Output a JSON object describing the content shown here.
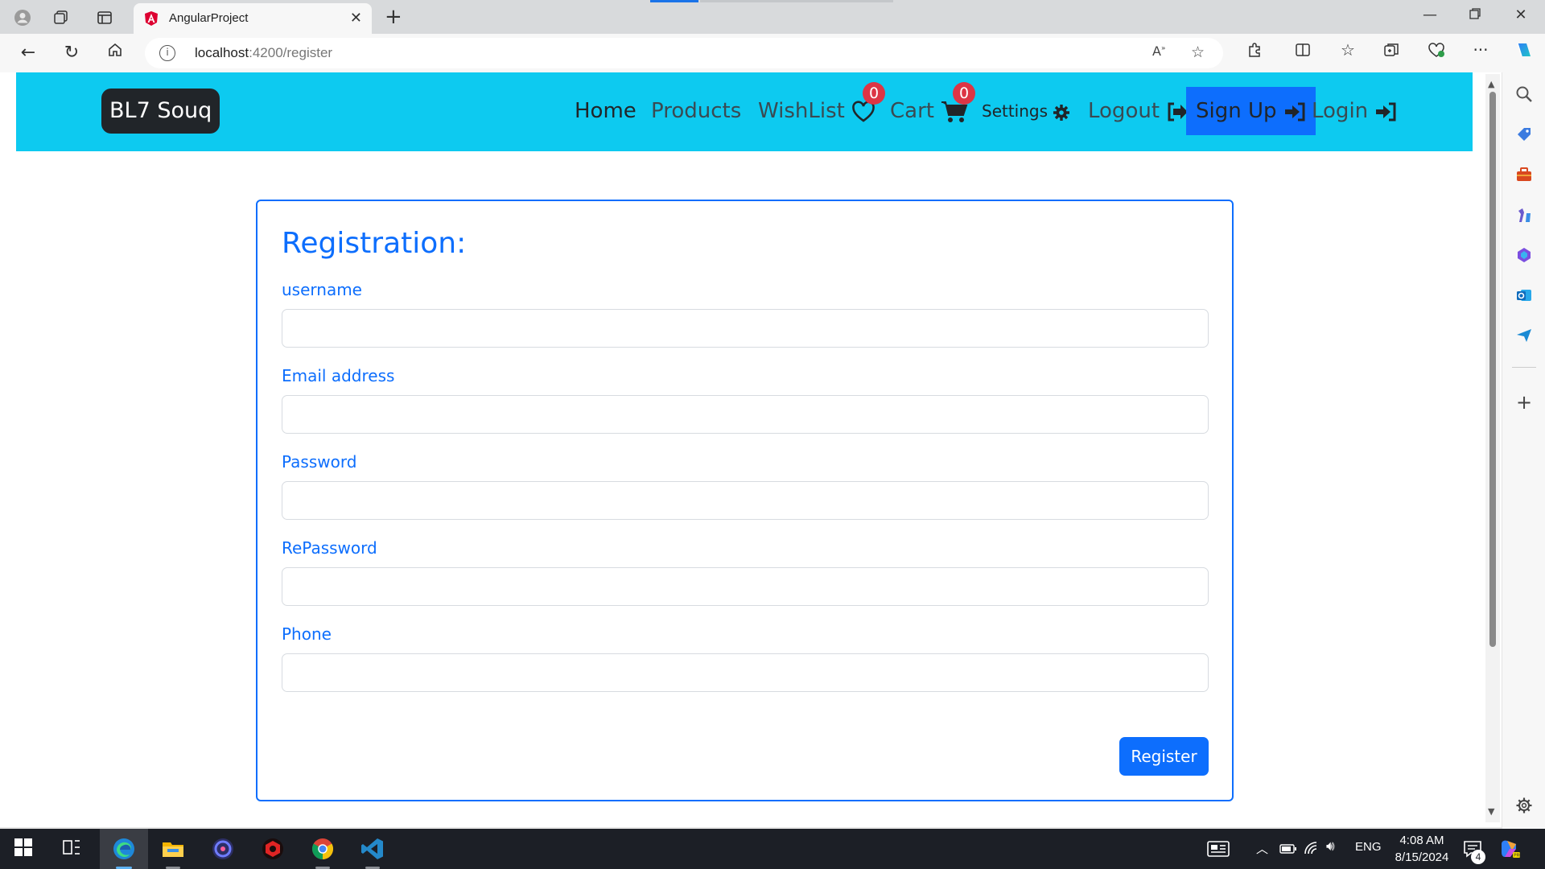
{
  "browser": {
    "tab_title": "AngularProject",
    "url_host": "localhost",
    "url_path": ":4200/register"
  },
  "navbar": {
    "brand": "BL7 Souq",
    "links": {
      "home": "Home",
      "products": "Products",
      "wishlist": "WishList",
      "cart": "Cart",
      "settings": "Settings",
      "logout": "Logout",
      "signup": "Sign Up",
      "login": "Login"
    },
    "wishlist_count": "0",
    "cart_count": "0"
  },
  "form": {
    "title": "Registration:",
    "fields": [
      {
        "label": "username",
        "value": ""
      },
      {
        "label": "Email address",
        "value": ""
      },
      {
        "label": "Password",
        "value": ""
      },
      {
        "label": "RePassword",
        "value": ""
      },
      {
        "label": "Phone",
        "value": ""
      }
    ],
    "submit_label": "Register"
  },
  "taskbar": {
    "language": "ENG",
    "time": "4:08 AM",
    "date": "8/15/2024",
    "notification_count": "4"
  },
  "colors": {
    "navbar_bg": "#0dcaf0",
    "primary": "#0d6efd",
    "badge": "#dc3545",
    "brand_bg": "#212529"
  }
}
